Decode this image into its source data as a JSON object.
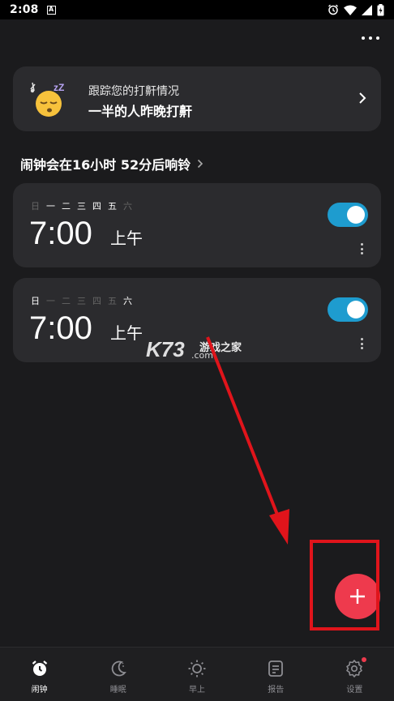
{
  "status_bar": {
    "time": "2:08",
    "notification_letter": "A"
  },
  "snore_card": {
    "subtitle": "跟踪您的打鼾情况",
    "headline": "一半的人昨晚打鼾",
    "emoji_text": "zZ"
  },
  "next_alarm": {
    "text": "闹钟会在16小时 52分后响铃"
  },
  "alarms": [
    {
      "days": [
        "日",
        "一",
        "二",
        "三",
        "四",
        "五",
        "六"
      ],
      "time": "7:00",
      "ampm": "上午",
      "enabled": true
    },
    {
      "days": [
        "日",
        "一",
        "二",
        "三",
        "四",
        "五",
        "六"
      ],
      "time": "7:00",
      "ampm": "上午",
      "enabled": true
    }
  ],
  "watermark": {
    "brand": "K73",
    "cn": "游戏之家",
    "domain": ".com"
  },
  "nav": [
    {
      "label": "闹钟",
      "icon": "alarm-clock-icon",
      "active": true
    },
    {
      "label": "睡眠",
      "icon": "moon-icon",
      "active": false
    },
    {
      "label": "早上",
      "icon": "sun-icon",
      "active": false
    },
    {
      "label": "报告",
      "icon": "report-icon",
      "active": false
    },
    {
      "label": "设置",
      "icon": "gear-icon",
      "active": false
    }
  ],
  "colors": {
    "accent": "#1e9ccf",
    "fab": "#ee3a4d",
    "annotation": "#e0141b",
    "card": "#2b2b2e",
    "background": "#1b1b1d"
  }
}
